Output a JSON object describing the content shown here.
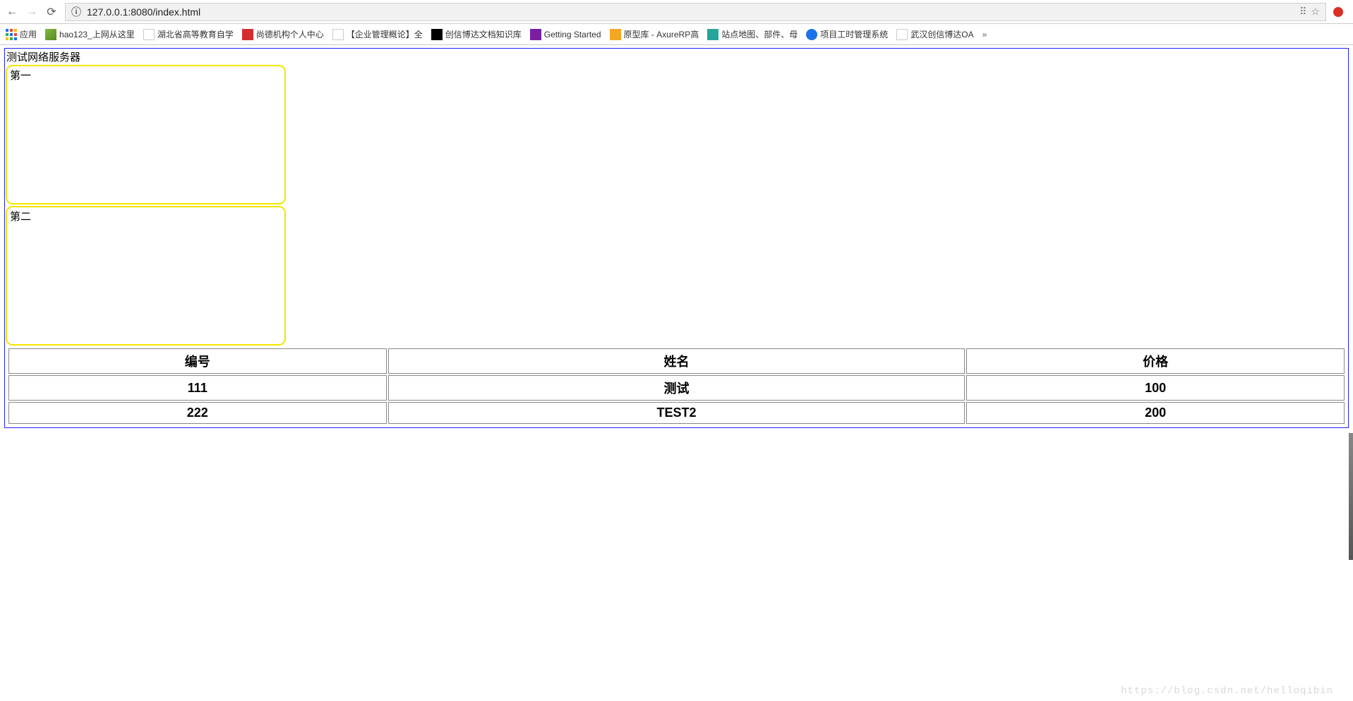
{
  "address_bar": {
    "url_display": "127.0.0.1:8080/index.html",
    "info_icon": "ⓘ"
  },
  "bookmarks_bar": {
    "apps_label": "应用",
    "items": [
      {
        "label": "hao123_上网从这里",
        "fav": "hao"
      },
      {
        "label": "湖北省高等教育自学",
        "fav": "plain"
      },
      {
        "label": "尚德机构个人中心",
        "fav": "red"
      },
      {
        "label": "【企业管理概论】全",
        "fav": "plain"
      },
      {
        "label": "创信博达文档知识库",
        "fav": "black"
      },
      {
        "label": "Getting Started",
        "fav": "purple"
      },
      {
        "label": "原型库 - AxureRP高",
        "fav": "orange"
      },
      {
        "label": "站点地图、部件、母",
        "fav": "teal"
      },
      {
        "label": "项目工时管理系统",
        "fav": "blue"
      },
      {
        "label": "武汉创信博达OA",
        "fav": "plain"
      }
    ],
    "overflow": "»"
  },
  "page": {
    "title": "测试网络服务器",
    "box1_label": "第一",
    "box2_label": "第二",
    "table": {
      "headers": [
        "编号",
        "姓名",
        "价格"
      ],
      "rows": [
        [
          "111",
          "测试",
          "100"
        ],
        [
          "222",
          "TEST2",
          "200"
        ]
      ]
    }
  },
  "watermark": "https://blog.csdn.net/helloqibin"
}
